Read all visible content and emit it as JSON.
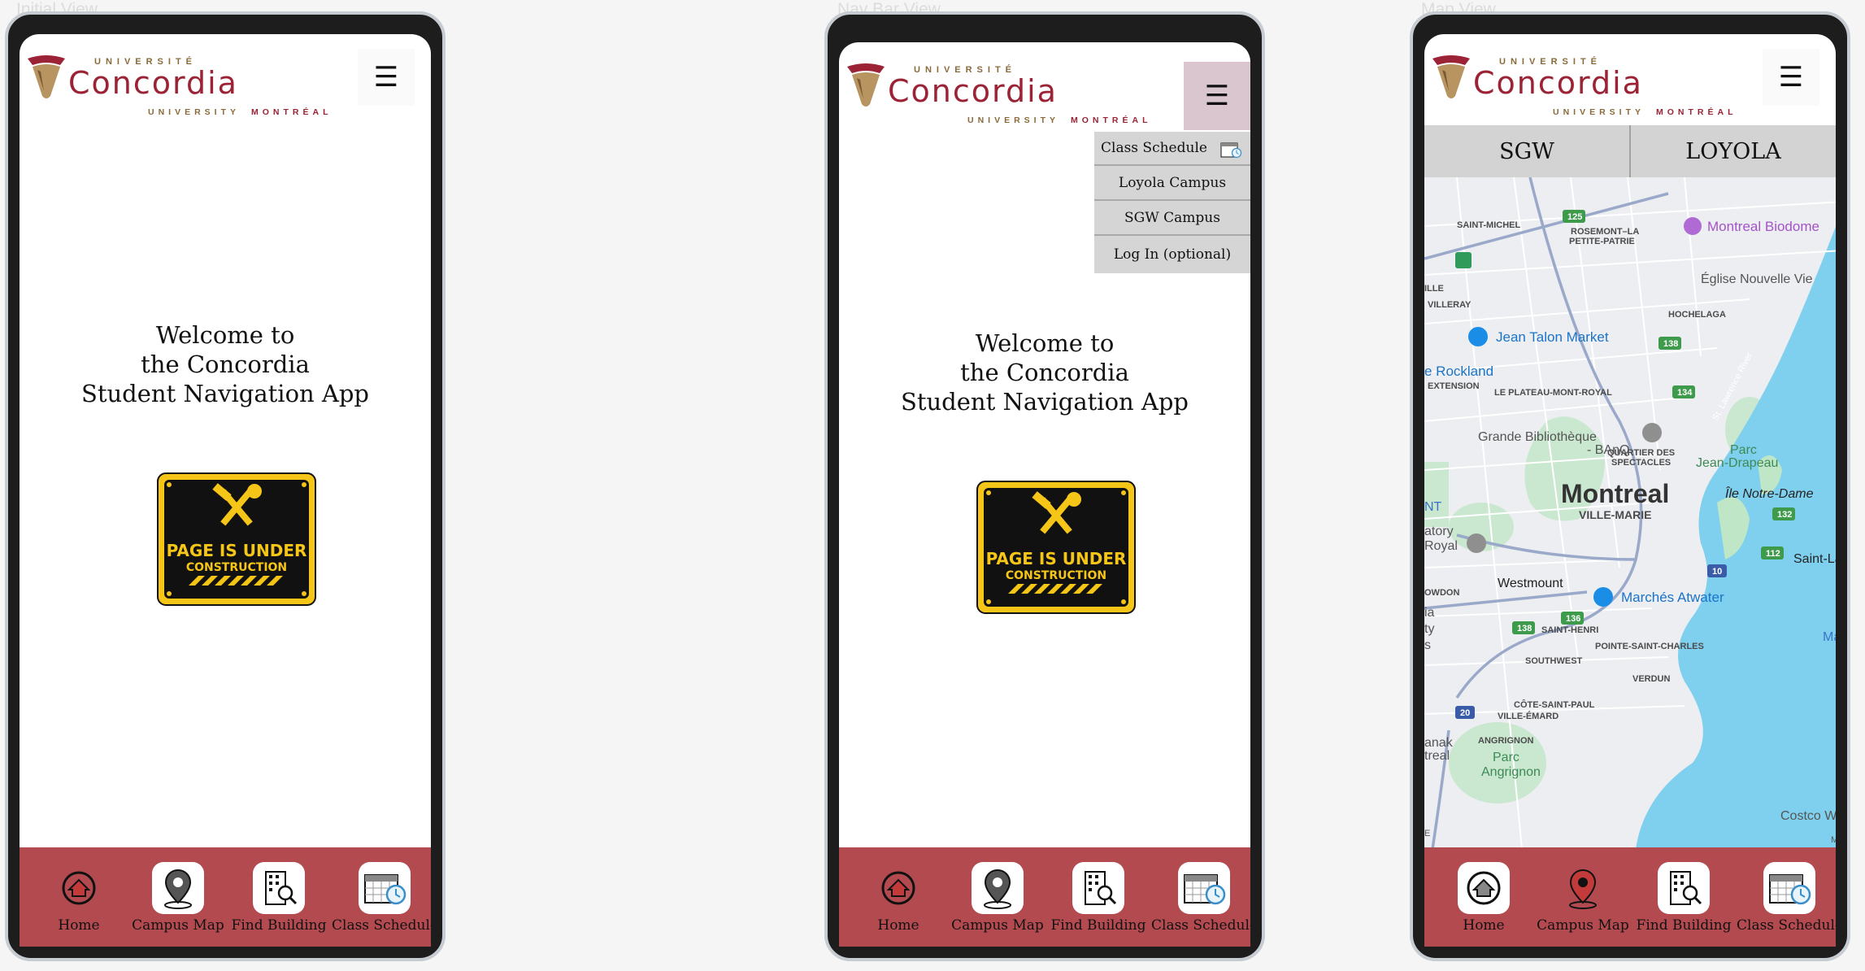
{
  "frames": [
    {
      "label": "Initial View"
    },
    {
      "label": "Nav Bar View"
    },
    {
      "label": "Map View"
    }
  ],
  "brand": {
    "top_text": "UNIVERSITÉ",
    "name": "Concordia",
    "bottom_text": "UNIVERSITY",
    "city": "MONTRÉAL",
    "primary_color": "#9b2335",
    "gold_color": "#8a6a3a"
  },
  "menu_icon": "☰",
  "welcome": {
    "line1": "Welcome to",
    "line2": "the Concordia",
    "line3": "Student Navigation App"
  },
  "construction": {
    "line1": "PAGE IS UNDER",
    "line2": "CONSTRUCTION",
    "icon": "hammer-wrench-icon"
  },
  "bottom_nav": {
    "color": "#b24a50",
    "items": [
      {
        "label": "Home",
        "icon": "home-icon"
      },
      {
        "label": "Campus Map",
        "icon": "map-pin-icon"
      },
      {
        "label": "Find Building",
        "icon": "building-search-icon"
      },
      {
        "label": "Class Schedule",
        "icon": "calendar-clock-icon"
      }
    ]
  },
  "dropdown": {
    "items": [
      {
        "label": "Class Schedule"
      },
      {
        "label": "Loyola Campus"
      },
      {
        "label": "SGW Campus"
      },
      {
        "label": "Log In (optional)"
      }
    ]
  },
  "campus_tabs": [
    "SGW",
    "LOYOLA"
  ],
  "map": {
    "city": "Montreal",
    "labels": {
      "saint_michel": "SAINT-MICHEL",
      "rosemont": "ROSEMONT–LA",
      "rosemont2": "PETITE-PATRIE",
      "biodome": "Montreal Biodome",
      "eglise": "Église Nouvelle Vie",
      "ille": "ILLE",
      "villeray": "VILLERAY",
      "hochelaga": "HOCHELAGA",
      "jean_talon": "Jean Talon Market",
      "rockland": "e Rockland",
      "extension": "EXTENSION",
      "plateau": "LE PLATEAU-MONT-ROYAL",
      "banq1": "Grande Bibliothèque",
      "banq2": "- BAnQ",
      "quartier1": "QUARTIER DES",
      "quartier2": "SPECTACLES",
      "parc_jd1": "Parc",
      "parc_jd2": "Jean-Drapeau",
      "ile_nd": "Île Notre-Dame",
      "ville_marie": "VILLE-MARIE",
      "nt": "NT",
      "oratory1": "atory",
      "oratory2": "Royal",
      "saint_la": "Saint-La",
      "westmount": "Westmount",
      "atwater": "Marchés Atwater",
      "owdon": "OWDON",
      "saint_henri": "SAINT-HENRI",
      "pointe": "POINTE-SAINT-CHARLES",
      "ma": "Ma",
      "southwest": "SOUTHWEST",
      "verdun": "VERDUN",
      "cote1": "CÔTE-SAINT-PAUL",
      "cote2": "VILLE-ÉMARD",
      "anak": "anak",
      "treal": "treal",
      "angrignon": "ANGRIGNON",
      "parc_ang1": "Parc",
      "parc_ang2": "Angrignon",
      "costco": "Costco W",
      "ia": "ia",
      "ty": "ty",
      "s": "s",
      "e": "E",
      "m": "M",
      "st_lawrence": "St. Lawrence River"
    },
    "routes": [
      "125",
      "138",
      "134",
      "132",
      "112",
      "10",
      "136",
      "138",
      "20"
    ],
    "water_color": "#7fd0ee",
    "park_color": "#c9e8cf"
  }
}
